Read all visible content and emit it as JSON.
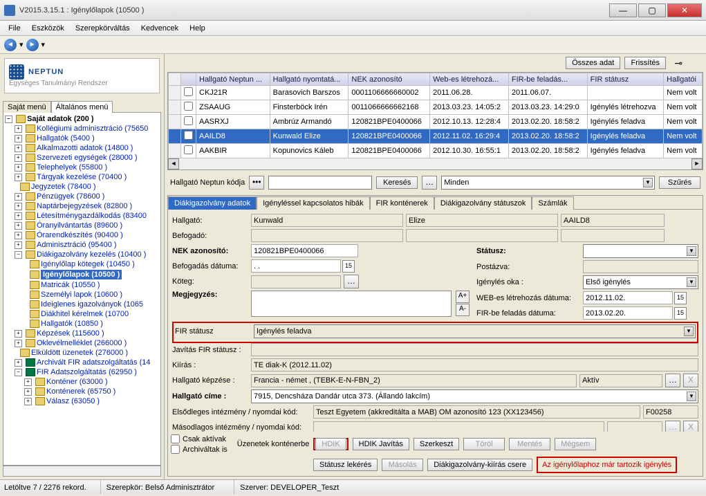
{
  "window": {
    "title": "V2015.3.15.1 : Igénylőlapok (10500  )"
  },
  "menu": {
    "file": "File",
    "tools": "Eszközök",
    "roles": "Szerepkörváltás",
    "fav": "Kedvencek",
    "help": "Help"
  },
  "logo": {
    "name": "NEPTUN",
    "sub": "Egységes Tanulmányi Rendszer"
  },
  "left_tabs": {
    "own": "Saját menü",
    "general": "Általános menü"
  },
  "tree": {
    "own_data": "Saját adatok (200  )",
    "items": [
      "Kollégiumi adminisztráció (75650",
      "Hallgatók (5400  )",
      "Alkalmazotti adatok (14800  )",
      "Szervezeti egységek (28000  )",
      "Telephelyek (55800  )",
      "Tárgyak kezelése (70400  )",
      "Jegyzetek (78400  )",
      "Pénzügyek (78600  )",
      "Naptárbejegyzések (82800  )",
      "Létesítménygazdálkodás (83400",
      "Óranyilvántartás (89600  )",
      "Órarendkészítés (90400  )",
      "Adminisztráció (95400  )",
      "Diákigazolvány kezelés (10400  )"
    ],
    "sub1": "Igénylőlap kötegek (10450  )",
    "sub2": "Igénylőlapok  (10500  )",
    "sub3": "Matricák (10550  )",
    "sub4": "Személyi lapok (10600  )",
    "sub5": "Ideiglenes igazolványok (1065",
    "sub6": "Diákhitel kérelmek (10700",
    "sub7": "Hallgatók (10850  )",
    "items2": [
      "Képzések (115600  )",
      "Oklevélmelléklet (266000  )",
      "Elküldött üzenetek (276000  )",
      "Archivált FIR adatszolgáltatás (14",
      "FIR Adatszolgáltatás (62950  )"
    ],
    "fir1": "Konténer (63000  )",
    "fir2": "Konténerek (65750  )",
    "fir3": "Válasz (63050  )"
  },
  "top_buttons": {
    "all": "Összes adat",
    "refresh": "Frissítés"
  },
  "grid": {
    "headers": {
      "code": "Hallgató Neptun ...",
      "name": "Hallgató nyomtatá...",
      "nek": "NEK azonosító",
      "web": "Web-es létrehozá...",
      "fir": "FIR-be feladás...",
      "status": "FIR státusz",
      "hall": "Hallgatói"
    },
    "rows": [
      {
        "code": "CKJ21R",
        "name": "Barasovich Barszos",
        "nek": "0001106666660002",
        "web": "2011.06.28.",
        "fir": "2011.06.07.",
        "status": "",
        "hall": "Nem volt"
      },
      {
        "code": "ZSAAUG",
        "name": "Finsterböck Irén",
        "nek": "0011066666662168",
        "web": "2013.03.23. 14:05:2",
        "fir": "2013.03.23. 14:29:0",
        "status": "Igénylés létrehozva",
        "hall": "Nem volt"
      },
      {
        "code": "AASRXJ",
        "name": "Ambrúz Armandó",
        "nek": "120821BPE0400066",
        "web": "2012.10.13. 12:28:4",
        "fir": "2013.02.20. 18:58:2",
        "status": "Igénylés feladva",
        "hall": "Nem volt"
      },
      {
        "code": "AAILD8",
        "name": "Kunwald Elize",
        "nek": "120821BPE0400066",
        "web": "2012.11.02. 16:29:4",
        "fir": "2013.02.20. 18:58:2",
        "status": "Igénylés feladva",
        "hall": "Nem volt"
      },
      {
        "code": "AAKBIR",
        "name": "Kopunovics Káleb",
        "nek": "120821BPE0400066",
        "web": "2012.10.30. 16:55:1",
        "fir": "2013.02.20. 18:58:2",
        "status": "Igénylés feladva",
        "hall": "Nem volt"
      }
    ]
  },
  "search": {
    "label": "Hallgató Neptun kódja",
    "mask": "•••",
    "search_btn": "Keresés",
    "all": "Minden",
    "filter": "Szűrés"
  },
  "tabs": {
    "t1": "Diákigazolvány adatok",
    "t2": "Igényléssel kapcsolatos hibák",
    "t3": "FIR konténerek",
    "t4": "Diákigazolvány státuszok",
    "t5": "Számlák"
  },
  "form": {
    "hallgato_l": "Hallgató:",
    "last": "Kunwald",
    "first": "Elize",
    "code": "AAILD8",
    "befogado_l": "Befogadó:",
    "nek_l": "NEK azonosító:",
    "nek": "120821BPE0400066",
    "befdate_l": "Befogadás dátuma:",
    "befdate": " .   .",
    "koteg_l": "Köteg:",
    "megj_l": "Megjegyzés:",
    "status_l": "Státusz:",
    "post_l": "Postázva:",
    "igok_l": "Igénylés oka :",
    "igok": "Első igénylés",
    "webdate_l": "WEB-es létrehozás dátuma:",
    "webdate": "2012.11.02.",
    "firdate_l": "FIR-be feladás dátuma:",
    "firdate": "2013.02.20.",
    "firstat_l": "FIR státusz",
    "firstat": "Igénylés feladva",
    "javstat_l": "Javítás FIR státusz :",
    "kiiras_l": "Kiírás :",
    "kiiras": "TE diak-K (2012.11.02)",
    "kepzes_l": "Hallgató képzése :",
    "kepzes": "Francia - német , (TEBK-E-N-FBN_2)",
    "aktiv": "Aktív",
    "cim_l": "Hallgató címe :",
    "cim": "7915, Dencsháza Dandár utca 373. (Állandó lakcím)",
    "elsod_l": "Elsődleges intézmény / nyomdai kód:",
    "elsod": "Teszt Egyetem (akkreditálta a MAB) OM azonosító 123 (XX123456)",
    "elsod_kod": "F00258",
    "masod_l": "Másodlagos intézmény / nyomdai kód:"
  },
  "bottom": {
    "csak": "Csak aktívak",
    "arch": "Archiváltak is",
    "uzen": "Üzenetek konténerbe",
    "hdik": "HDIK",
    "hdikj": "HDIK Javítás",
    "szerk": "Szerkeszt",
    "torol": "Töröl",
    "ment": "Mentés",
    "megse": "Mégsem",
    "statlek": "Státusz lekérés",
    "masol": "Másolás",
    "csere": "Diákigazolvány-kiírás csere",
    "rednote": "Az igénylőlaphoz már tartozik igénylés"
  },
  "status": {
    "rec": "Letöltve 7 / 2276 rekord.",
    "role": "Szerepkör: Belső Adminisztrátor",
    "server": "Szerver: DEVELOPER_Teszt"
  }
}
